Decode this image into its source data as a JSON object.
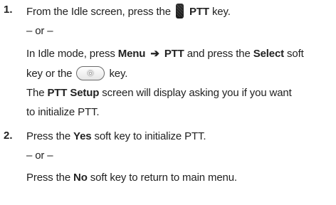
{
  "steps": [
    {
      "number": "1.",
      "line1": {
        "before": "From the Idle screen, press the",
        "key": "PTT",
        "after": "key."
      },
      "or": "– or –",
      "line3": {
        "before": "In Idle mode, press",
        "menu": "Menu",
        "arrow": "➔",
        "ptt": "PTT",
        "mid": "and press the",
        "select": "Select",
        "after": "soft"
      },
      "line4": {
        "before": "key or the",
        "after": "key."
      },
      "line5": {
        "before": "The",
        "setup": "PTT Setup",
        "after": "screen will display asking you if you want"
      },
      "line6": "to initialize PTT."
    },
    {
      "number": "2.",
      "line1": {
        "before": "Press the",
        "yes": "Yes",
        "after": "soft key to initialize PTT."
      },
      "or": "– or –",
      "line3": {
        "before": "Press the",
        "no": "No",
        "after": "soft key to return to main menu."
      }
    }
  ]
}
